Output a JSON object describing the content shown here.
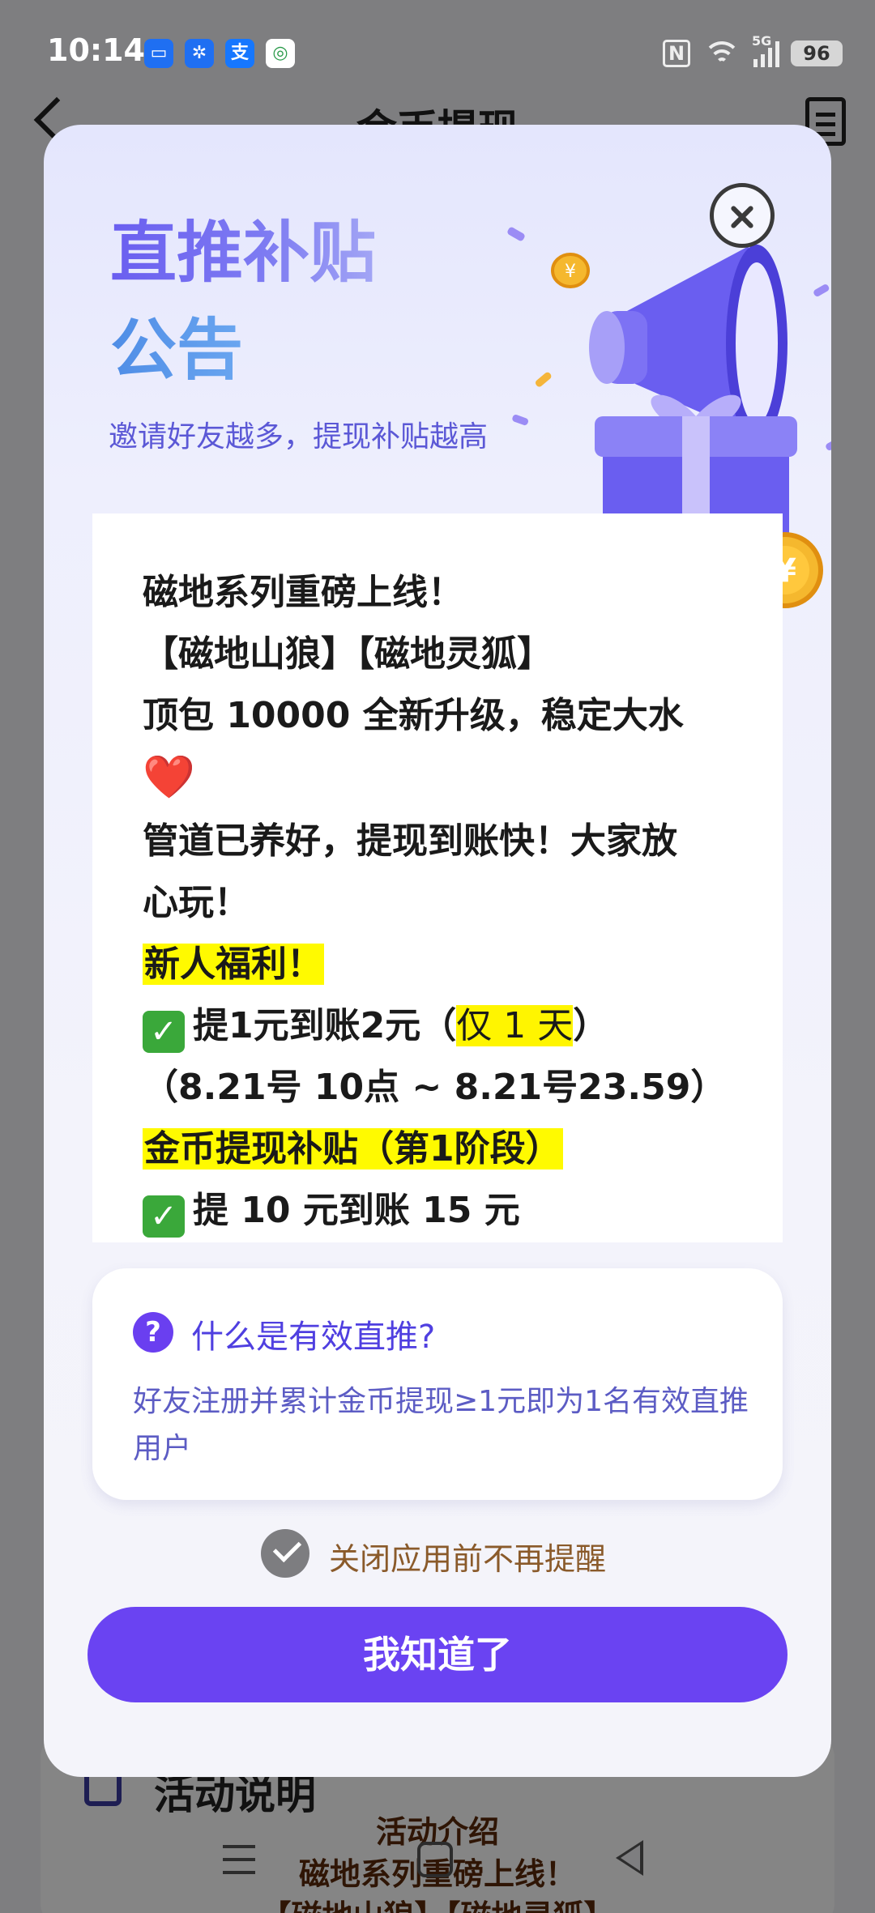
{
  "status_bar": {
    "time": "10:14",
    "battery": "96",
    "signal_label": "5G",
    "nfc_label": "N"
  },
  "background_page": {
    "title": "金币提现",
    "card_heading": "活动说明",
    "intro_lines": [
      "活动介绍",
      "磁地系列重磅上线！",
      "【磁地山狼】【磁地灵狐】"
    ]
  },
  "modal": {
    "title_line1": "直推补贴",
    "title_line2": "公告",
    "subtitle": "邀请好友越多，提现补贴越高",
    "announcement": {
      "line1": "磁地系列重磅上线！",
      "line2": "【磁地山狼】【磁地灵狐】",
      "line3": "顶包 10000 全新升级，稳定大水",
      "line4_heart": "❤️",
      "line5": "管道已养好，提现到账快！大家放",
      "line6": "心玩！",
      "line7_highlight": "新人福利！",
      "line8_pre": "提1元到账2元（",
      "line8_highlight": "仅 1 天",
      "line8_post": "）",
      "line9": "（8.21号 10点 ~ 8.21号23.59）",
      "line10_highlight": "金币提现补贴（第1阶段）",
      "line11": "提 10 元到账 15 元"
    },
    "info_card": {
      "title": "什么是有效直推?",
      "text": "好友注册并累计金币提现≥1元即为1名有效直推用户"
    },
    "remember_label": "关闭应用前不再提醒",
    "ok_button": "我知道了"
  },
  "colors": {
    "accent": "#6a43f2",
    "title_gradient_start": "#6a5ef0",
    "subtitle": "#5b58d6",
    "highlight": "#fffa00",
    "check_green": "#3aa83a"
  },
  "icons": {
    "close": "close-icon",
    "question": "question-circle-icon",
    "check": "check-mark-icon",
    "megaphone": "megaphone-gift-illustration"
  }
}
